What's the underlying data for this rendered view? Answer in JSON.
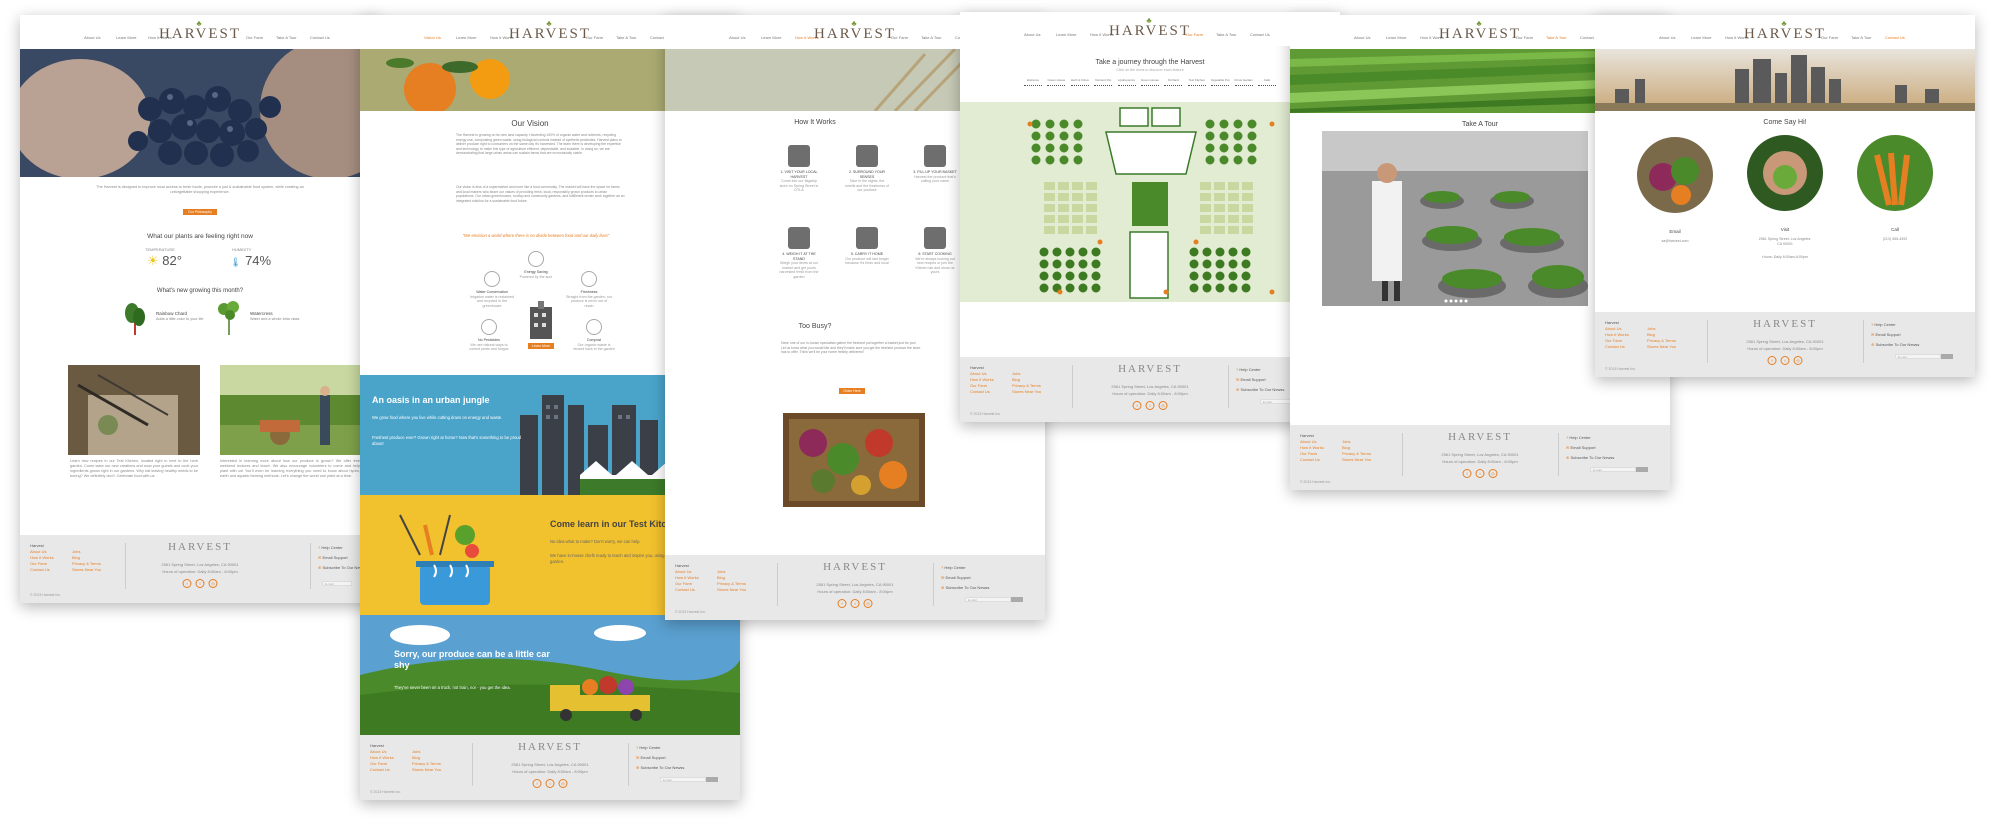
{
  "brand": {
    "logo": "HARVEST"
  },
  "nav": {
    "about": "About Us",
    "learn": "Learn More",
    "how": "How It Works",
    "farm": "Our Farm",
    "tour": "Take A Tour",
    "contact": "Contact Us",
    "vision": "Vision Us"
  },
  "footer": {
    "title": "Harvest",
    "links_left": [
      "About Us",
      "How It Works",
      "Our Farm",
      "Contact Us"
    ],
    "links_mid": [
      "Jobs",
      "Blog",
      "Privacy & Terms",
      "Stores Near You"
    ],
    "address": "2561 Spring Street, Los Angeles, CA 90001",
    "hours": "Hours of operation: Daily 8:00am - 8:00pm",
    "help": "Help Center",
    "email_support": "Email Support",
    "subscribe": "Subscribe To Our Newss",
    "email_placeholder": "E-mail",
    "copyright": "© 2013 Harvest Inc."
  },
  "page1": {
    "intro": "The Harvest is designed to improve local access to fresh foods, promote a just & sustainable food system, while creating an unforgettable shopping experience.",
    "button": "Our Philosophy",
    "feeling_title": "What our plants are feeling right now",
    "temp_label": "TEMPERATURE",
    "temp_value": "82°",
    "humidity_label": "HUMIDITY",
    "humidity_value": "74%",
    "growing_title": "What's new growing this month?",
    "crop1_name": "Rainbow Chard",
    "crop1_desc": "Adds a little color to your life",
    "crop2_name": "Watercress",
    "crop2_desc": "Water and a whole lotta class",
    "col1": "Learn new recipes in our Test Kitchen, located right in next to the herb garden. Come taste our new creations and wow your guests and cook your ingredients grown right in our gardens. Why eat leaving healthy needs to be boring? We definitely don't. Celebrate food with us.",
    "col2": "Interested in learning more about how our produce is grown? We offer free weekend lectures and teach. We also encourage volunteers to come and help plant with us! You'll even be learning everything you need to know about hydro, earth and aquatic farming methods. Let's change the world one plant at a time."
  },
  "page2": {
    "vision_title": "Our Vision",
    "vision_p1": "The Harvest is growing on its new land capacity. Harvesting 100% of organic water and nutrients, recycling energy use, composting green waste, using biological controls instead of synthetic pesticides. Harvest plans to deliver produce right to consumers on the same day it's harvested. The team there is developing the expertise and technology to make this type of agriculture efficient, dependable, and scalable. In doing so, we are demonstrating that large urban areas can sustain farms that are economically viable.",
    "vision_p2": "Our vision is less of a supermarket and more like a food community. The market will have the space for farms and local makers who share our values of providing fresh, local, responsibly grown products to urban populations. Our urban greenhouses, rooftop and community gardens, and fulfillment center work together as an integrated solution for a sustainable food future.",
    "quote": "\"We envision a world where there is no divide between food and our daily lives\"",
    "feat_water": "Water Conservation",
    "feat_water_d": "Irrigation water is reclaimed and recycled in the greenhouse",
    "feat_energy": "Energy Saving",
    "feat_energy_d": "Powered by the sun!",
    "feat_fresh": "Freshness",
    "feat_fresh_d": "Straight from the garden, our produce is never out of reach",
    "feat_pest": "No Pesticides",
    "feat_pest_d": "We use natural ways to control pests and fungus",
    "feat_compost": "Compost",
    "feat_compost_d": "Our organic waste is reused back in the garden",
    "learn_button": "Learn More",
    "band1_title": "An oasis in an urban jungle",
    "band1_p1": "We grow food where you live while cutting down on energy and waste.",
    "band1_p2": "Freshest produce ever? Grown right at home? Now that's something to be proud about!",
    "band2_title": "Come learn in our Test Kitchen",
    "band2_p1": "No idea what to make? Don't worry, we can help.",
    "band2_p2": "We have in-house chefs ready to teach and inspire you, using ingredients straight from our garden.",
    "band3_title": "Sorry, our produce can be a little car shy",
    "band3_p": "They've never been on a truck, not train, nor - you get the idea."
  },
  "page3": {
    "title": "How It Works",
    "steps": [
      {
        "n": "1. VISIT YOUR LOCAL HARVEST",
        "d": "Come into our flagship store on Spring Street in DTLA"
      },
      {
        "n": "2. SURROUND YOUR SENSES",
        "d": "Take in the sights, the smells and the freshness of our produce"
      },
      {
        "n": "3. FILL UP YOUR BASKET",
        "d": "Harvest the produce that's calling your name"
      },
      {
        "n": "4. WEIGH IT AT THE STAND",
        "d": "Weigh your items at our market and get yours harvested fresh from the garden"
      },
      {
        "n": "5. CARRY IT HOME",
        "d": "Our produce will last longer because it's fresh and local"
      },
      {
        "n": "6. START COOKING",
        "d": "We're always looking out new recipes or join the Kitchen lab and show us yours"
      }
    ],
    "busy_title": "Too Busy?",
    "busy_p": "Have one of our in-house specialists gather the freshest put together a basket just for you! Let us know what you would like and they'll make sure you get the freshest produce the store has to offer. Think we'll be your home freshly delivered!",
    "button": "Order Here"
  },
  "page4": {
    "title": "Take a journey through the Harvest",
    "subtitle": "Click on the icons to discover each feature",
    "tabs": [
      "Entrance",
      "Green House",
      "Herb & Citrus",
      "Nutrient Pot",
      "Hydroponics",
      "Green House",
      "Orchard",
      "Test Kitchen",
      "Vegetable Pot",
      "Citrus Garden",
      "Café"
    ]
  },
  "page5": {
    "title": "Take A Tour"
  },
  "page6": {
    "title": "Come Say Hi!",
    "email_label": "Email",
    "email_value": "sa@harvest.com",
    "visit_label": "Visit",
    "visit_value": "2561 Spring Street, Los Angeles, CA 90001",
    "visit_hours": "Hours: Daily 8:00am-8:00pm",
    "call_label": "Call",
    "call_value": "(213) 555-4392"
  }
}
